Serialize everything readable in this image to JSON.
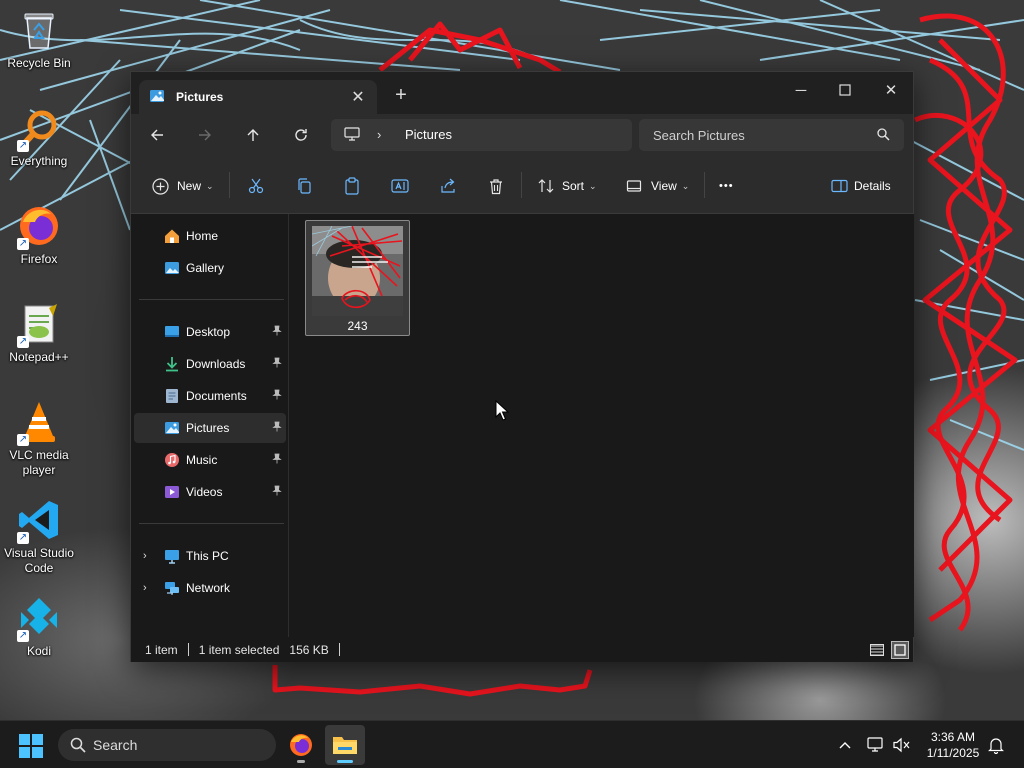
{
  "desktop": {
    "icons": [
      {
        "label": "Recycle Bin",
        "icon": "recycle-bin-icon"
      },
      {
        "label": "Everything",
        "icon": "everything-search-icon"
      },
      {
        "label": "Firefox",
        "icon": "firefox-icon"
      },
      {
        "label": "Notepad++",
        "icon": "notepad-plus-plus-icon"
      },
      {
        "label": "VLC media player",
        "icon": "vlc-icon"
      },
      {
        "label": "Visual Studio Code",
        "icon": "vscode-icon"
      },
      {
        "label": "Kodi",
        "icon": "kodi-icon"
      }
    ]
  },
  "window": {
    "tab_title": "Pictures",
    "tab_close": "✕",
    "new_tab": "+",
    "controls": {
      "minimize": "─",
      "maximize": "☐",
      "close": "✕"
    }
  },
  "navbar": {
    "address_segment": "Pictures",
    "search_placeholder": "Search Pictures"
  },
  "commandbar": {
    "new_label": "New",
    "sort_label": "Sort",
    "view_label": "View",
    "more_label": "•••",
    "details_label": "Details"
  },
  "sidebar": {
    "quick": [
      {
        "label": "Home",
        "icon": "home-icon"
      },
      {
        "label": "Gallery",
        "icon": "gallery-icon"
      }
    ],
    "pinned": [
      {
        "label": "Desktop",
        "icon": "desktop-folder-icon",
        "pinned": true
      },
      {
        "label": "Downloads",
        "icon": "downloads-icon",
        "pinned": true
      },
      {
        "label": "Documents",
        "icon": "documents-icon",
        "pinned": true
      },
      {
        "label": "Pictures",
        "icon": "pictures-icon",
        "pinned": true,
        "selected": true
      },
      {
        "label": "Music",
        "icon": "music-icon",
        "pinned": true
      },
      {
        "label": "Videos",
        "icon": "videos-icon",
        "pinned": true
      }
    ],
    "locations": [
      {
        "label": "This PC",
        "icon": "this-pc-icon"
      },
      {
        "label": "Network",
        "icon": "network-icon"
      }
    ],
    "pin_glyph": "📌"
  },
  "content": {
    "files": [
      {
        "name": "243",
        "type": "image",
        "selected": true
      }
    ]
  },
  "statusbar": {
    "item_count": "1 item",
    "selection": "1 item selected",
    "size": "156 KB"
  },
  "taskbar": {
    "search_label": "Search",
    "time": "3:36 AM",
    "date": "1/11/2025",
    "tray_chevron": "^"
  },
  "colors": {
    "accent": "#60cdff",
    "window_bg": "#191919",
    "chrome_bg": "#2c2c2c",
    "wallpaper_scribble_red": "#e8141e",
    "wallpaper_scribble_blue": "#9fd8ef"
  }
}
